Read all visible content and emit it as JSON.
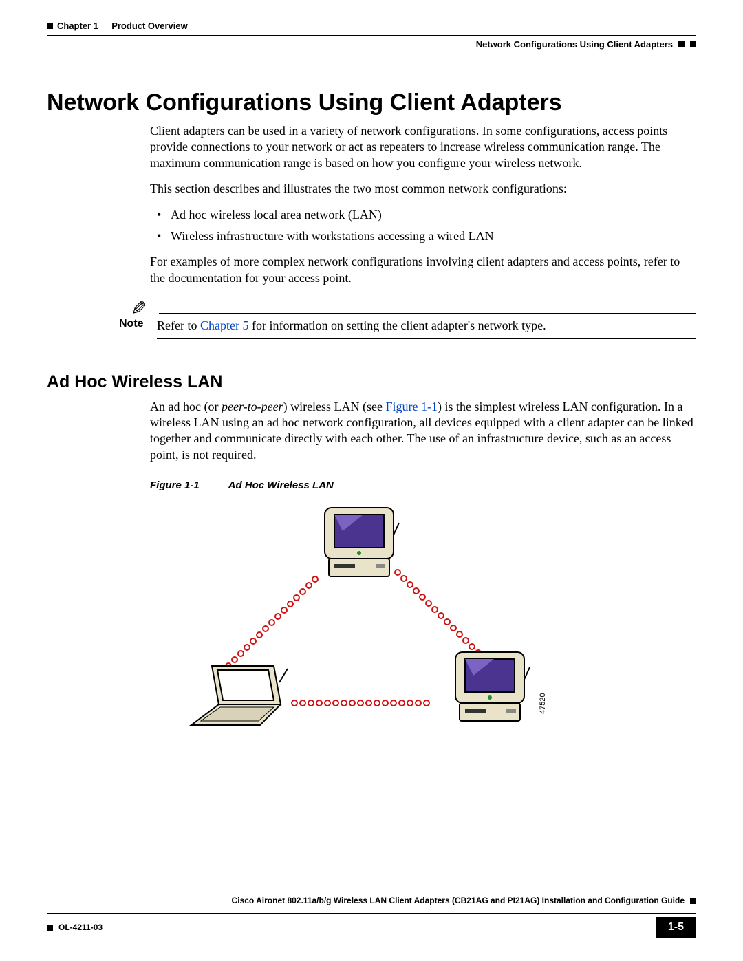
{
  "header": {
    "chapter_label": "Chapter 1",
    "chapter_title": "Product Overview",
    "section_right": "Network Configurations Using Client Adapters"
  },
  "main": {
    "h1": "Network Configurations Using Client Adapters",
    "p1": "Client adapters can be used in a variety of network configurations. In some configurations, access points provide connections to your network or act as repeaters to increase wireless communication range. The maximum communication range is based on how you configure your wireless network.",
    "p2": "This section describes and illustrates the two most common network configurations:",
    "bullets": {
      "b1": "Ad hoc wireless local area network (LAN)",
      "b2": "Wireless infrastructure with workstations accessing a wired LAN"
    },
    "p3": "For examples of more complex network configurations involving client adapters and access points, refer to the documentation for your access point."
  },
  "note": {
    "label": "Note",
    "text_pre": "Refer to ",
    "link": "Chapter 5",
    "text_post": " for information on setting the client adapter's network type."
  },
  "sub": {
    "h2": "Ad Hoc Wireless LAN",
    "p1_a": "An ad hoc (or ",
    "p1_italic": "peer-to-peer",
    "p1_b": ") wireless LAN (see ",
    "p1_link": "Figure 1-1",
    "p1_c": ") is the simplest wireless LAN configuration. In a wireless LAN using an ad hoc network configuration, all devices equipped with a client adapter can be linked together and communicate directly with each other. The use of an infrastructure device, such as an access point, is not required.",
    "fig_num": "Figure 1-1",
    "fig_title": "Ad Hoc Wireless LAN",
    "fig_id": "47520"
  },
  "footer": {
    "guide_title": "Cisco Aironet 802.11a/b/g Wireless LAN Client Adapters (CB21AG and PI21AG) Installation and Configuration Guide",
    "doc_id": "OL-4211-03",
    "page": "1-5"
  }
}
